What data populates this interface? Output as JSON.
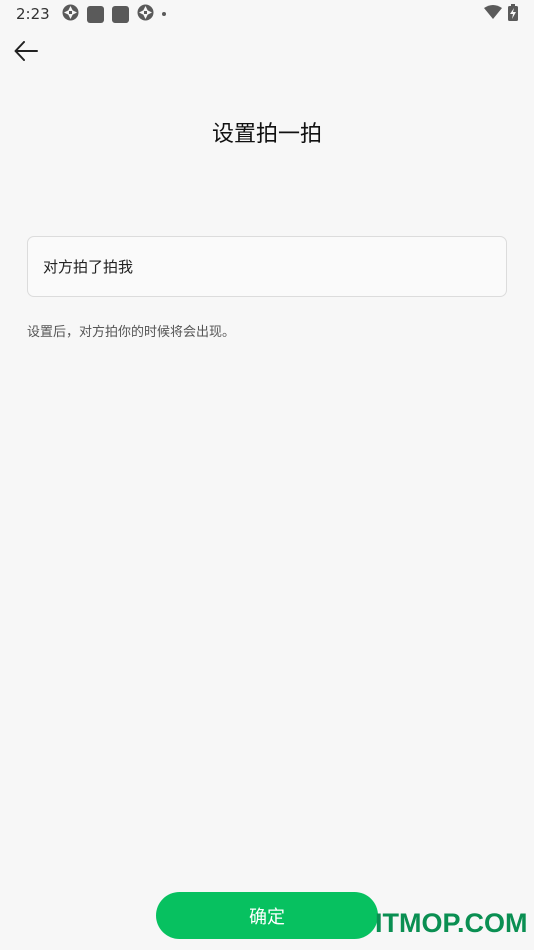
{
  "status_bar": {
    "time": "2:23",
    "icons": [
      "aperture-icon",
      "app-square-icon",
      "app-square-icon",
      "aperture-icon",
      "notification-dot-icon",
      "wifi-icon",
      "battery-charging-icon"
    ]
  },
  "header": {
    "back_icon": "arrow-left-icon"
  },
  "main": {
    "title": "设置拍一拍",
    "input_value": "对方拍了拍我",
    "hint": "设置后，对方拍你的时候将会出现。"
  },
  "footer": {
    "confirm_label": "确定"
  },
  "watermark": {
    "text": "ITMOP.COM"
  },
  "colors": {
    "background": "#f7f7f7",
    "accent": "#07c160"
  }
}
